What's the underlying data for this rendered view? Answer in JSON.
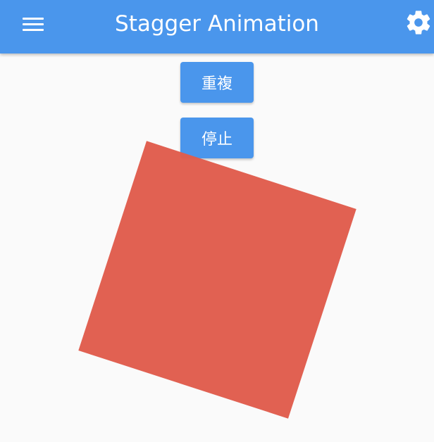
{
  "app_bar": {
    "title": "Stagger Animation",
    "background_color": "#4a96ec",
    "menu_icon": "menu-icon",
    "settings_icon": "gear-icon"
  },
  "buttons": {
    "repeat_label": "重複",
    "stop_label": "停止"
  },
  "animated_square": {
    "color": "#e05c4c"
  },
  "page": {
    "background_color": "#fafafa"
  }
}
